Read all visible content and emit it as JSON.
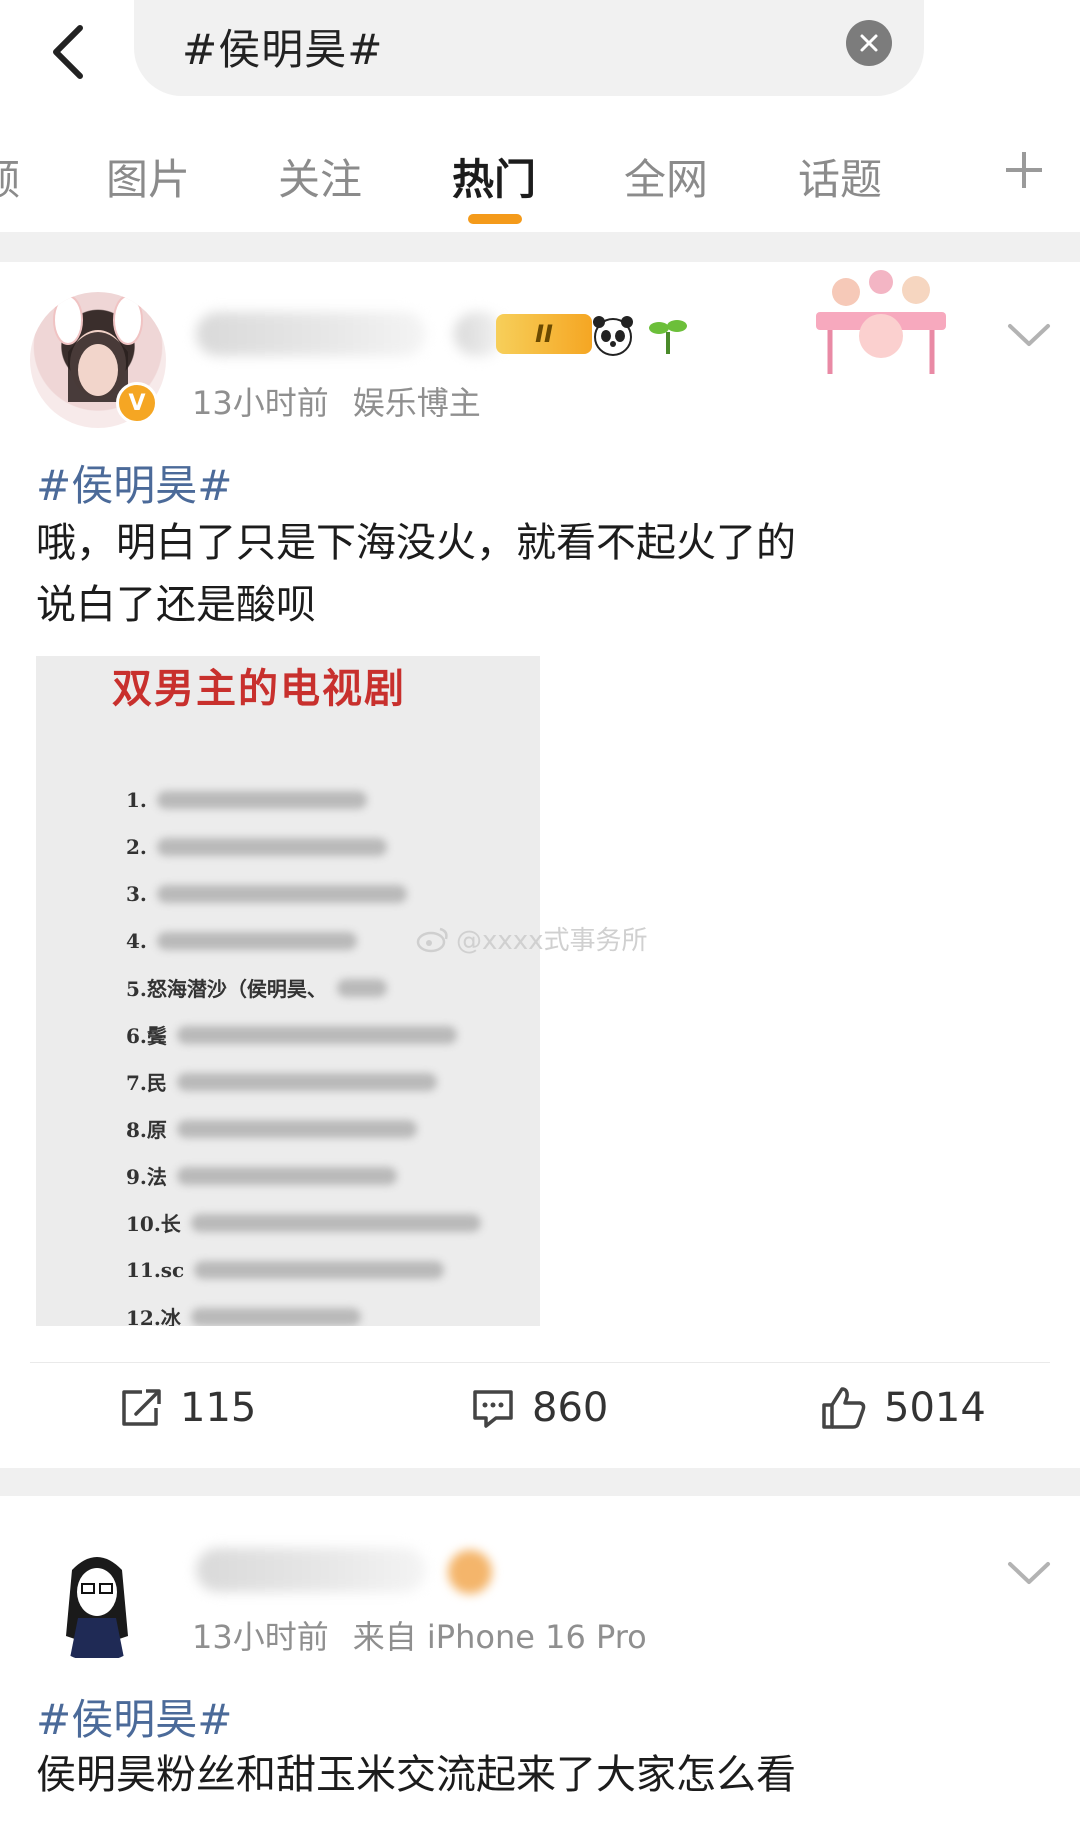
{
  "search": {
    "query": "#侯明昊#"
  },
  "tabs": [
    {
      "label": "频",
      "active": false
    },
    {
      "label": "图片",
      "active": false
    },
    {
      "label": "关注",
      "active": false
    },
    {
      "label": "热门",
      "active": true
    },
    {
      "label": "全网",
      "active": false
    },
    {
      "label": "话题",
      "active": false
    }
  ],
  "posts": [
    {
      "time": "13小时前",
      "source": "娱乐博主",
      "rank_badge": "II",
      "hashtag": "#侯明昊#",
      "text_line1": "哦，明白了只是下海没火，就看不起火了的",
      "text_line2": "说白了还是酸呗",
      "image": {
        "title": "双男主的电视剧",
        "list": [
          "1.",
          "2.",
          "3.",
          "4.",
          "5.怒海潜沙（侯明昊、",
          "6.鬓",
          "7.民",
          "8.原",
          "9.法",
          "10.长",
          "11.sc",
          "12.冰"
        ],
        "watermark": "@xxxx式事务所"
      },
      "actions": {
        "repost": "115",
        "comment": "860",
        "like": "5014"
      }
    },
    {
      "time": "13小时前",
      "source": "来自 iPhone 16 Pro",
      "hashtag": "#侯明昊#",
      "text_line1": "侯明昊粉丝和甜玉米交流起来了大家怎么看"
    }
  ]
}
